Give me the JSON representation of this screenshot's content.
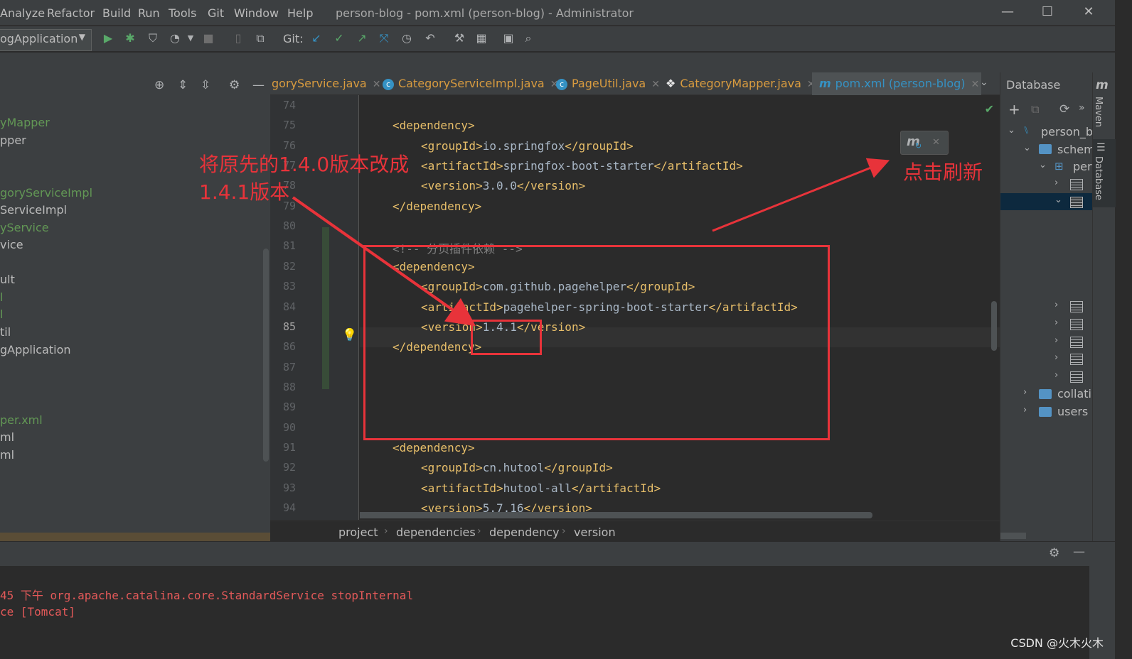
{
  "menu": [
    "Analyze",
    "Refactor",
    "Build",
    "Run",
    "Tools",
    "Git",
    "Window",
    "Help"
  ],
  "window_title": "person-blog - pom.xml (person-blog) - Administrator",
  "toolbar": {
    "run_config": "ogApplication",
    "git_label": "Git:"
  },
  "project_tree": [
    {
      "label": "yMapper",
      "style": "green"
    },
    {
      "label": "pper",
      "style": "plain"
    },
    {
      "label": "goryServiceImpl",
      "style": "green"
    },
    {
      "label": "ServiceImpl",
      "style": "plain"
    },
    {
      "label": "yService",
      "style": "green"
    },
    {
      "label": "vice",
      "style": "plain"
    },
    {
      "label": "ult",
      "style": "plain"
    },
    {
      "label": "l",
      "style": "green"
    },
    {
      "label": "l",
      "style": "green"
    },
    {
      "label": "til",
      "style": "plain"
    },
    {
      "label": "gApplication",
      "style": "plain"
    },
    {
      "label": "per.xml",
      "style": "green"
    },
    {
      "label": "ml",
      "style": "plain"
    },
    {
      "label": "ml",
      "style": "plain"
    }
  ],
  "tabs": [
    {
      "label": "goryService.java",
      "icon": ""
    },
    {
      "label": "CategoryServiceImpl.java",
      "icon": "c"
    },
    {
      "label": "PageUtil.java",
      "icon": "c"
    },
    {
      "label": "CategoryMapper.java",
      "icon": "mapper"
    },
    {
      "label": "pom.xml (person-blog)",
      "icon": "m",
      "active": true
    }
  ],
  "code_lines": [
    {
      "n": "74",
      "text": ""
    },
    {
      "n": "75",
      "text": "<dependency>",
      "indent": 1
    },
    {
      "n": "76",
      "text": "<groupId>io.springfox</groupId>",
      "indent": 2
    },
    {
      "n": "77",
      "text": "<artifactId>springfox-boot-starter</artifactId>",
      "indent": 2
    },
    {
      "n": "78",
      "text": "<version>3.0.0</version>",
      "indent": 2
    },
    {
      "n": "79",
      "text": "</dependency>",
      "indent": 1
    },
    {
      "n": "80",
      "text": ""
    },
    {
      "n": "81",
      "text": "<!-- 分页插件依赖 -->",
      "indent": 1,
      "comment": true
    },
    {
      "n": "82",
      "text": "<dependency>",
      "indent": 1
    },
    {
      "n": "83",
      "text": "<groupId>com.github.pagehelper</groupId>",
      "indent": 2
    },
    {
      "n": "84",
      "text": "<artifactId>pagehelper-spring-boot-starter</artifactId>",
      "indent": 2
    },
    {
      "n": "85",
      "text": "<version>1.4.1</version>",
      "indent": 2
    },
    {
      "n": "86",
      "text": "</dependency>",
      "indent": 1
    },
    {
      "n": "87",
      "text": ""
    },
    {
      "n": "88",
      "text": ""
    },
    {
      "n": "89",
      "text": ""
    },
    {
      "n": "90",
      "text": ""
    },
    {
      "n": "91",
      "text": "<dependency>",
      "indent": 1
    },
    {
      "n": "92",
      "text": "<groupId>cn.hutool</groupId>",
      "indent": 2
    },
    {
      "n": "93",
      "text": "<artifactId>hutool-all</artifactId>",
      "indent": 2
    },
    {
      "n": "94",
      "text": "<version>5.7.16</version>",
      "indent": 2
    }
  ],
  "breadcrumb": [
    "project",
    "dependencies",
    "dependency",
    "version"
  ],
  "database": {
    "title": "Database",
    "items": [
      "person_bl",
      "schem",
      "per",
      "collati",
      "users"
    ]
  },
  "side_labels": {
    "maven": "Maven",
    "database": "Database"
  },
  "log_lines": [
    "45 下午 org.apache.catalina.core.StandardService stopInternal",
    "ce [Tomcat]"
  ],
  "annotations": {
    "left_note_line1": "将原先的1.4.0版本改成",
    "left_note_line2": "1.4.1版本",
    "right_note": "点击刷新"
  },
  "watermark": "CSDN @火木火木",
  "colors": {
    "annotation": "#e8333a",
    "accent_tab": "#3592c4",
    "run_green": "#59a869"
  }
}
